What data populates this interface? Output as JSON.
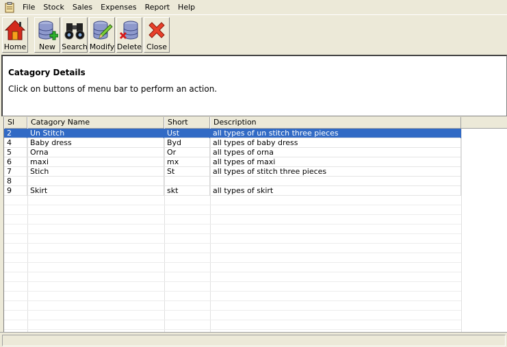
{
  "menu": {
    "items": [
      "File",
      "Stock",
      "Sales",
      "Expenses",
      "Report",
      "Help"
    ]
  },
  "toolbar": {
    "buttons": [
      {
        "label": "Home",
        "icon": "home-icon"
      },
      {
        "label": "New",
        "icon": "database-add-icon"
      },
      {
        "label": "Search",
        "icon": "binoculars-icon"
      },
      {
        "label": "Modify",
        "icon": "database-edit-icon"
      },
      {
        "label": "Delete",
        "icon": "database-delete-icon"
      },
      {
        "label": "Close",
        "icon": "close-icon"
      }
    ]
  },
  "header": {
    "title": "Catagory Details",
    "subtitle": "Click on buttons of menu bar to perform an action."
  },
  "grid": {
    "columns": [
      "Sl",
      "Catagory Name",
      "Short",
      "Description"
    ],
    "rows": [
      [
        "2",
        "Un Stitch",
        "Ust",
        "all types of un stitch three pieces"
      ],
      [
        "4",
        "Baby dress",
        "Byd",
        "all types of baby dress"
      ],
      [
        "5",
        "Orna",
        "Or",
        "all types of orna"
      ],
      [
        "6",
        "maxi",
        "mx",
        "all types of maxi"
      ],
      [
        "7",
        "Stich",
        "St",
        "all types of stitch three pieces"
      ],
      [
        "8",
        "",
        "",
        ""
      ],
      [
        "9",
        "Skirt",
        "skt",
        "all types of skirt"
      ]
    ],
    "selected_row": 0
  },
  "colors": {
    "selection": "#316ac5",
    "chrome": "#ece9d8"
  }
}
